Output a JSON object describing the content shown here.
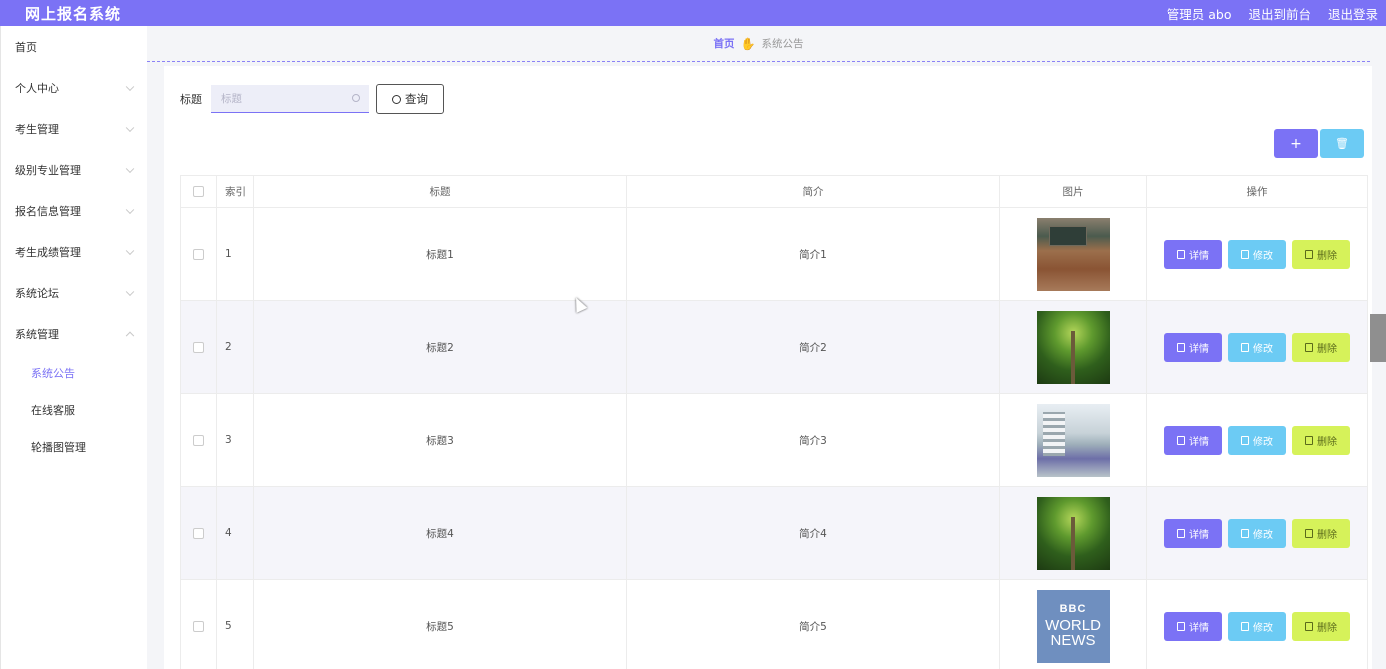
{
  "header": {
    "brand": "网上报名系统",
    "admin": "管理员 abo",
    "to_front": "退出到前台",
    "logout": "退出登录"
  },
  "sidebar": {
    "items": [
      {
        "label": "首页",
        "chevron": "none"
      },
      {
        "label": "个人中心",
        "chevron": "down"
      },
      {
        "label": "考生管理",
        "chevron": "down"
      },
      {
        "label": "级别专业管理",
        "chevron": "down"
      },
      {
        "label": "报名信息管理",
        "chevron": "down"
      },
      {
        "label": "考生成绩管理",
        "chevron": "down"
      },
      {
        "label": "系统论坛",
        "chevron": "down"
      },
      {
        "label": "系统管理",
        "chevron": "up"
      }
    ],
    "subitems": [
      {
        "label": "系统公告",
        "active": true
      },
      {
        "label": "在线客服",
        "active": false
      },
      {
        "label": "轮播图管理",
        "active": false
      }
    ]
  },
  "breadcrumb": {
    "home": "首页",
    "current": "系统公告"
  },
  "search": {
    "label": "标题",
    "placeholder": "标题",
    "button": "查询"
  },
  "toolbar": {
    "add": "+",
    "delete": "🗑"
  },
  "table": {
    "headers": [
      "",
      "索引",
      "标题",
      "简介",
      "图片",
      "操作"
    ],
    "rows": [
      {
        "index": "1",
        "title": "标题1",
        "intro": "简介1",
        "image": "classroom"
      },
      {
        "index": "2",
        "title": "标题2",
        "intro": "简介2",
        "image": "forest"
      },
      {
        "index": "3",
        "title": "标题3",
        "intro": "简介3",
        "image": "building"
      },
      {
        "index": "4",
        "title": "标题4",
        "intro": "简介4",
        "image": "forest"
      },
      {
        "index": "5",
        "title": "标题5",
        "intro": "简介5",
        "image": "bbc"
      }
    ],
    "actions": {
      "detail": "详情",
      "edit": "修改",
      "remove": "删除"
    },
    "bbc_text": [
      "BBC",
      "WORLD",
      "NEWS"
    ]
  },
  "colors": {
    "accent": "#7b72f5",
    "info": "#6ccbf4",
    "lime": "#d6f25a"
  }
}
